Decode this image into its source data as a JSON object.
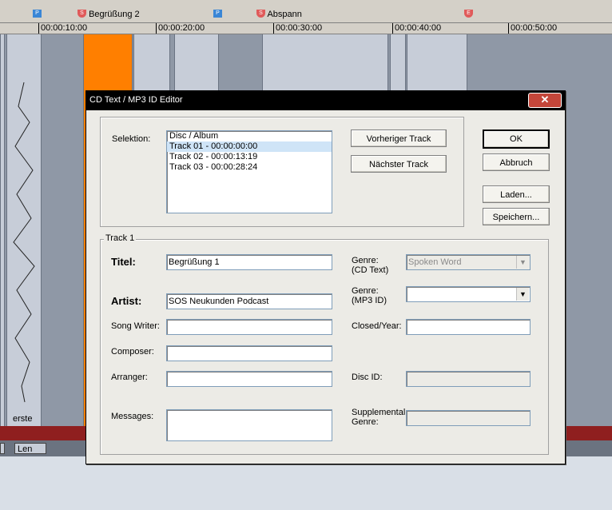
{
  "timeline": {
    "markers": [
      {
        "tag": "P",
        "label": ""
      },
      {
        "tag": "S",
        "label": "Begrüßung 2"
      },
      {
        "tag": "P",
        "label": ""
      },
      {
        "tag": "S",
        "label": "Abspann"
      },
      {
        "tag": "E",
        "label": ""
      }
    ],
    "ruler": [
      "00:00:10:00",
      "00:00:20:00",
      "00:00:30:00",
      "00:00:40:00",
      "00:00:50:00"
    ],
    "clip_label": "erste",
    "len_label": "Len"
  },
  "dialog": {
    "title": "CD Text / MP3 ID Editor",
    "close_glyph": "✕",
    "selektion_label": "Selektion:",
    "list_items": [
      "Disc / Album",
      "Track 01  -  00:00:00:00",
      "Track 02  -  00:00:13:19",
      "Track 03  -  00:00:28:24"
    ],
    "selected_index": 1,
    "prev_track": "Vorheriger Track",
    "next_track": "Nächster Track",
    "ok": "OK",
    "cancel": "Abbruch",
    "load": "Laden...",
    "save": "Speichern...",
    "group_label": "Track 1",
    "fields": {
      "titel_label": "Titel:",
      "titel_value": "Begrüßung 1",
      "artist_label": "Artist:",
      "artist_value": "SOS Neukunden Podcast",
      "songwriter_label": "Song Writer:",
      "songwriter_value": "",
      "composer_label": "Composer:",
      "composer_value": "",
      "arranger_label": "Arranger:",
      "arranger_value": "",
      "messages_label": "Messages:",
      "messages_value": "",
      "genre_cd_label_1": "Genre:",
      "genre_cd_label_2": "(CD Text)",
      "genre_cd_value": "Spoken Word",
      "genre_mp3_label_1": "Genre:",
      "genre_mp3_label_2": "(MP3 ID)",
      "genre_mp3_value": "",
      "closed_year_label": "Closed/Year:",
      "closed_year_value": "",
      "disc_id_label": "Disc ID:",
      "disc_id_value": "",
      "supp_genre_label_1": "Supplemental",
      "supp_genre_label_2": "Genre:",
      "supp_genre_value": ""
    },
    "combo_arrow": "▼"
  }
}
